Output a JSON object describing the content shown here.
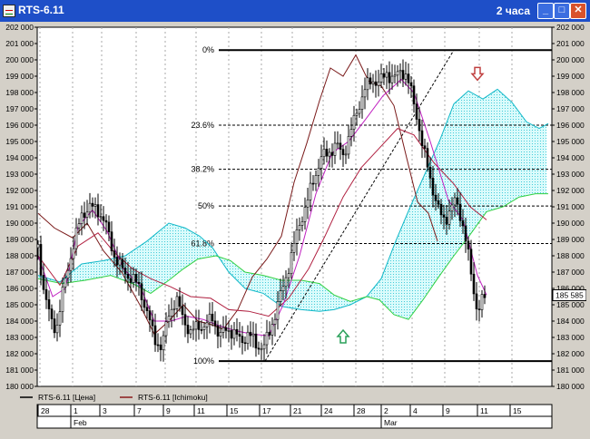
{
  "window": {
    "title": "RTS-6.11",
    "timeframe": "2 часа",
    "buttons": {
      "minimize": "_",
      "maximize": "□",
      "close": "✕"
    }
  },
  "chart_data": {
    "type": "candlestick",
    "ylim": [
      180000,
      202000
    ],
    "y_ticks": [
      "180 000",
      "181 000",
      "182 000",
      "183 000",
      "184 000",
      "185 000",
      "186 000",
      "187 000",
      "188 000",
      "189 000",
      "190 000",
      "191 000",
      "192 000",
      "193 000",
      "194 000",
      "195 000",
      "196 000",
      "197 000",
      "198 000",
      "199 000",
      "200 000",
      "201 000",
      "202 000"
    ],
    "x_day_labels": [
      "28",
      "1",
      "3",
      "7",
      "9",
      "11",
      "15",
      "17",
      "21",
      "24",
      "28",
      "2",
      "4",
      "9",
      "11",
      "15"
    ],
    "x_month_labels": [
      {
        "label": "Feb",
        "at_day": "1"
      },
      {
        "label": "Mar",
        "at_day": "2"
      }
    ],
    "current_price_label": "185 585",
    "current_price": 185585,
    "fibonacci": [
      {
        "label": "0%",
        "value": 200600
      },
      {
        "label": "23.6%",
        "value": 196000
      },
      {
        "label": "38.2%",
        "value": 193300
      },
      {
        "label": "50%",
        "value": 191050
      },
      {
        "label": "61.8%",
        "value": 188750
      },
      {
        "label": "100%",
        "value": 181550
      }
    ],
    "legend": [
      {
        "name": "RTS-6.11 [Цена]",
        "color": "#000000"
      },
      {
        "name": "RTS-6.11 [Ichimoku]",
        "color": "#8b1a1a"
      }
    ],
    "price_path": [
      [
        0,
        188500
      ],
      [
        6,
        186000
      ],
      [
        14,
        184000
      ],
      [
        20,
        183500
      ],
      [
        28,
        186000
      ],
      [
        38,
        188500
      ],
      [
        48,
        190500
      ],
      [
        56,
        191000
      ],
      [
        66,
        190800
      ],
      [
        74,
        190000
      ],
      [
        84,
        188000
      ],
      [
        94,
        187000
      ],
      [
        104,
        186600
      ],
      [
        112,
        186000
      ],
      [
        120,
        184500
      ],
      [
        128,
        183000
      ],
      [
        136,
        182300
      ],
      [
        144,
        184500
      ],
      [
        152,
        185300
      ],
      [
        160,
        184200
      ],
      [
        168,
        183200
      ],
      [
        176,
        183800
      ],
      [
        184,
        183600
      ],
      [
        192,
        184300
      ],
      [
        200,
        183000
      ],
      [
        208,
        183600
      ],
      [
        216,
        183200
      ],
      [
        224,
        182800
      ],
      [
        232,
        183200
      ],
      [
        240,
        182600
      ],
      [
        248,
        182300
      ],
      [
        256,
        183500
      ],
      [
        264,
        185000
      ],
      [
        272,
        186500
      ],
      [
        280,
        188200
      ],
      [
        288,
        190000
      ],
      [
        296,
        191200
      ],
      [
        304,
        192800
      ],
      [
        312,
        194000
      ],
      [
        320,
        194300
      ],
      [
        328,
        194800
      ],
      [
        336,
        194200
      ],
      [
        344,
        195500
      ],
      [
        352,
        197000
      ],
      [
        360,
        198200
      ],
      [
        368,
        198800
      ],
      [
        376,
        198600
      ],
      [
        384,
        199200
      ],
      [
        392,
        198800
      ],
      [
        400,
        199400
      ],
      [
        406,
        199000
      ],
      [
        412,
        197800
      ],
      [
        418,
        196400
      ],
      [
        424,
        194500
      ],
      [
        430,
        193300
      ],
      [
        436,
        191800
      ],
      [
        442,
        190600
      ],
      [
        448,
        190200
      ],
      [
        454,
        190800
      ],
      [
        460,
        191400
      ],
      [
        466,
        190400
      ],
      [
        472,
        188700
      ],
      [
        478,
        186500
      ],
      [
        484,
        184600
      ],
      [
        490,
        185300
      ],
      [
        494,
        185585
      ]
    ],
    "tenkan": [
      [
        0,
        188000
      ],
      [
        16,
        185500
      ],
      [
        30,
        186000
      ],
      [
        44,
        189800
      ],
      [
        60,
        190800
      ],
      [
        76,
        189500
      ],
      [
        94,
        187200
      ],
      [
        112,
        186200
      ],
      [
        128,
        184000
      ],
      [
        146,
        184000
      ],
      [
        164,
        184300
      ],
      [
        182,
        184100
      ],
      [
        200,
        183700
      ],
      [
        218,
        183400
      ],
      [
        236,
        183200
      ],
      [
        254,
        183100
      ],
      [
        270,
        185000
      ],
      [
        288,
        188000
      ],
      [
        306,
        191800
      ],
      [
        324,
        194300
      ],
      [
        342,
        195000
      ],
      [
        360,
        196300
      ],
      [
        380,
        197800
      ],
      [
        400,
        198800
      ],
      [
        414,
        198000
      ],
      [
        432,
        195000
      ],
      [
        452,
        191400
      ],
      [
        468,
        190200
      ],
      [
        484,
        186800
      ],
      [
        494,
        185600
      ]
    ],
    "kijun": [
      [
        0,
        188000
      ],
      [
        24,
        186200
      ],
      [
        44,
        188600
      ],
      [
        66,
        189400
      ],
      [
        84,
        188200
      ],
      [
        104,
        187200
      ],
      [
        124,
        186600
      ],
      [
        146,
        186100
      ],
      [
        168,
        185500
      ],
      [
        190,
        185400
      ],
      [
        210,
        184700
      ],
      [
        232,
        184600
      ],
      [
        254,
        184300
      ],
      [
        276,
        185400
      ],
      [
        298,
        187200
      ],
      [
        316,
        189200
      ],
      [
        336,
        191600
      ],
      [
        356,
        193400
      ],
      [
        376,
        194600
      ],
      [
        396,
        195800
      ],
      [
        414,
        195400
      ],
      [
        436,
        193700
      ],
      [
        458,
        192400
      ],
      [
        476,
        191000
      ],
      [
        494,
        190200
      ]
    ],
    "chikou": [
      [
        0,
        190600
      ],
      [
        18,
        189700
      ],
      [
        38,
        189100
      ],
      [
        54,
        190000
      ],
      [
        72,
        188300
      ],
      [
        92,
        187000
      ],
      [
        112,
        185000
      ],
      [
        128,
        183200
      ],
      [
        144,
        184000
      ],
      [
        160,
        185000
      ],
      [
        176,
        184000
      ],
      [
        190,
        183800
      ],
      [
        204,
        183500
      ],
      [
        220,
        184700
      ],
      [
        236,
        186700
      ],
      [
        252,
        187800
      ],
      [
        268,
        189200
      ],
      [
        282,
        192500
      ],
      [
        296,
        194900
      ],
      [
        310,
        197500
      ],
      [
        322,
        199500
      ],
      [
        336,
        199000
      ],
      [
        350,
        200300
      ],
      [
        364,
        198700
      ],
      [
        378,
        198400
      ],
      [
        392,
        197200
      ],
      [
        406,
        194000
      ],
      [
        418,
        191300
      ],
      [
        430,
        190600
      ],
      [
        440,
        188900
      ]
    ],
    "senkou_a": [
      [
        0,
        186800
      ],
      [
        24,
        186400
      ],
      [
        48,
        187500
      ],
      [
        72,
        187700
      ],
      [
        96,
        188000
      ],
      [
        120,
        188900
      ],
      [
        144,
        190000
      ],
      [
        162,
        189700
      ],
      [
        178,
        189200
      ],
      [
        192,
        188500
      ],
      [
        210,
        187000
      ],
      [
        228,
        186000
      ],
      [
        248,
        185700
      ],
      [
        268,
        184900
      ],
      [
        290,
        184700
      ],
      [
        310,
        184600
      ],
      [
        326,
        184700
      ],
      [
        344,
        185000
      ],
      [
        362,
        185500
      ],
      [
        378,
        186600
      ],
      [
        394,
        188900
      ],
      [
        410,
        191000
      ],
      [
        426,
        193000
      ],
      [
        442,
        195000
      ],
      [
        458,
        197300
      ],
      [
        474,
        198100
      ],
      [
        490,
        197600
      ],
      [
        506,
        198200
      ],
      [
        522,
        197400
      ],
      [
        538,
        196200
      ],
      [
        552,
        195800
      ],
      [
        562,
        196100
      ]
    ],
    "senkou_b": [
      [
        0,
        186600
      ],
      [
        26,
        186300
      ],
      [
        52,
        186500
      ],
      [
        80,
        186800
      ],
      [
        104,
        186300
      ],
      [
        124,
        185700
      ],
      [
        144,
        186500
      ],
      [
        160,
        187200
      ],
      [
        176,
        187800
      ],
      [
        196,
        188000
      ],
      [
        212,
        187700
      ],
      [
        228,
        187000
      ],
      [
        248,
        186800
      ],
      [
        268,
        186500
      ],
      [
        290,
        186500
      ],
      [
        310,
        186300
      ],
      [
        326,
        185600
      ],
      [
        344,
        185200
      ],
      [
        362,
        185500
      ],
      [
        376,
        185300
      ],
      [
        392,
        184400
      ],
      [
        408,
        184100
      ],
      [
        424,
        185300
      ],
      [
        440,
        186600
      ],
      [
        458,
        188000
      ],
      [
        476,
        189300
      ],
      [
        494,
        190700
      ],
      [
        512,
        191000
      ],
      [
        530,
        191600
      ],
      [
        548,
        191800
      ],
      [
        562,
        191800
      ]
    ],
    "annotations": [
      {
        "type": "arrow-up",
        "color": "#2aa05a",
        "x_index": 336,
        "value": 183000
      },
      {
        "type": "arrow-down",
        "color": "#c04040",
        "x_index": 484,
        "value": 199200
      }
    ]
  }
}
